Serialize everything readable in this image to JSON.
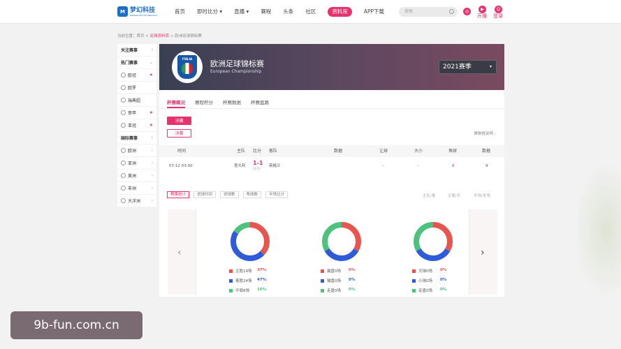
{
  "header": {
    "logo_cn": "梦幻科技",
    "logo_en": "MENGHUAN TECHNOLOGY",
    "logo_mark": "M",
    "nav": [
      "首页",
      "即时比分 ▾",
      "直播 ▾",
      "赛程",
      "头条",
      "社区",
      "资料库",
      "APP下载"
    ],
    "nav_active": "资料库",
    "search_placeholder": "搜索",
    "open_label": "开播",
    "login_label": "登录"
  },
  "breadcrumb": {
    "prefix": "当前位置：",
    "home": "首页",
    "sep1": " > ",
    "db": "足球资料库",
    "sep2": " > ",
    "current": "欧洲足球锦标赛"
  },
  "sidebar": {
    "items": [
      {
        "label": "关注赛事",
        "type": "head",
        "mark": "›"
      },
      {
        "label": "热门赛事",
        "type": "head",
        "mark": "⌄"
      },
      {
        "label": "欧冠",
        "type": "item",
        "mark": "★"
      },
      {
        "label": "欧罗",
        "type": "item",
        "mark": ""
      },
      {
        "label": "瑞典超",
        "type": "item",
        "mark": ""
      },
      {
        "label": "意甲",
        "type": "item",
        "mark": "★"
      },
      {
        "label": "亚冠",
        "type": "item",
        "mark": "★"
      },
      {
        "label": "国际赛事",
        "type": "head",
        "mark": "›"
      },
      {
        "label": "欧洲",
        "type": "item",
        "mark": "›"
      },
      {
        "label": "亚洲",
        "type": "item",
        "mark": "›"
      },
      {
        "label": "美洲",
        "type": "item",
        "mark": "›"
      },
      {
        "label": "非洲",
        "type": "item",
        "mark": "›"
      },
      {
        "label": "大洋洲",
        "type": "item",
        "mark": "›"
      }
    ]
  },
  "banner": {
    "crest_text": "ITALIA",
    "name_cn": "欧洲足球锦标赛",
    "name_en": "European Championship",
    "season": "2021赛季",
    "season_caret": "▾"
  },
  "tabs": [
    "杯赛概况",
    "赛程积分",
    "杯赛数据",
    "杯赛盘路"
  ],
  "stages": [
    "决赛",
    "决赛"
  ],
  "data_link": "赛数据说明 ›",
  "table": {
    "headers": [
      "时间",
      "主队",
      "比分",
      "客队",
      "数据",
      "让球",
      "大小",
      "角球",
      "数据"
    ],
    "row": {
      "time": "07-12 03:00",
      "home": "意大利",
      "score": "1-1",
      "score_sub": "(3-2)",
      "away": "英格兰",
      "handicap": "-",
      "ou": "-",
      "corner": "8",
      "data": "9"
    }
  },
  "filters": [
    "赛果统计",
    "进球时间",
    "进球数",
    "角球数",
    "半场比分"
  ],
  "filter_active": "赛果统计",
  "legend_top": [
    "主队/客",
    "主客/平",
    "半场/全场"
  ],
  "nav_arrows": {
    "left": "‹",
    "right": "›"
  },
  "chart_data": [
    {
      "type": "pie",
      "labels": [
        "主胜19场",
        "客胜24场",
        "平局8场"
      ],
      "values": [
        37,
        47,
        16
      ],
      "percent_labels": [
        "37%",
        "47%",
        "16%"
      ],
      "colors": [
        "#e8554e",
        "#2f5bd9",
        "#4cc27e"
      ]
    },
    {
      "type": "pie",
      "labels": [
        "赢盘0场",
        "输盘0场",
        "走盘0场"
      ],
      "values": [
        0,
        0,
        0
      ],
      "percent_labels": [
        "0%",
        "0%",
        "0%"
      ],
      "colors": [
        "#e8554e",
        "#2f5bd9",
        "#4cc27e"
      ]
    },
    {
      "type": "pie",
      "labels": [
        "大球0场",
        "小球0场",
        "走盘0场"
      ],
      "values": [
        0,
        0,
        0
      ],
      "percent_labels": [
        "0%",
        "0%",
        "0%"
      ],
      "colors": [
        "#e8554e",
        "#2f5bd9",
        "#4cc27e"
      ]
    }
  ],
  "watermark": "9b-fun.com.cn"
}
